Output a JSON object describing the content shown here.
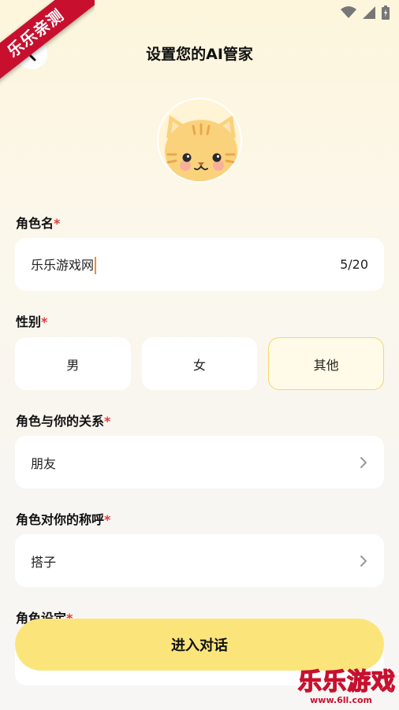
{
  "ribbon": {
    "text": "乐乐亲测"
  },
  "header": {
    "title": "设置您的AI管家"
  },
  "fields": {
    "role_name": {
      "label": "角色名",
      "value": "乐乐游戏网",
      "counter": "5/20"
    },
    "gender": {
      "label": "性别",
      "options": [
        "男",
        "女",
        "其他"
      ],
      "selected": "其他"
    },
    "relationship": {
      "label": "角色与你的关系",
      "value": "朋友"
    },
    "address": {
      "label": "角色对你的称呼",
      "value": "搭子"
    },
    "setting": {
      "label": "角色设定"
    }
  },
  "required_mark": "*",
  "actions": {
    "enter_label": "进入对话"
  },
  "watermark": {
    "text": "乐乐游戏",
    "url": "www.6ll.com"
  },
  "colors": {
    "accent": "#fbe57b",
    "required": "#e53935",
    "ribbon": "#c8102e",
    "caret": "#f28a2e"
  },
  "icons": [
    "wifi-icon",
    "signal-icon",
    "battery-icon",
    "back-arrow-icon",
    "cat-avatar",
    "chevron-right-icon"
  ]
}
